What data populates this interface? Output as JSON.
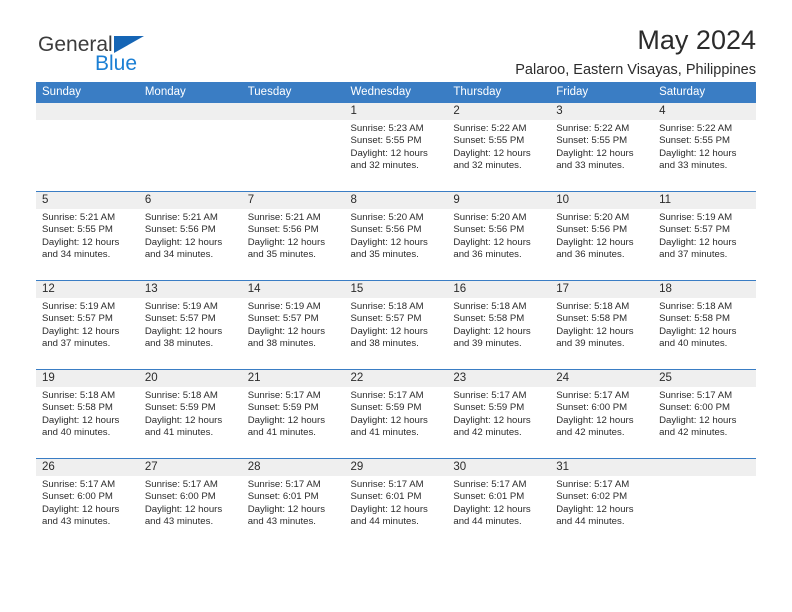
{
  "brand": {
    "name_part1": "General",
    "name_part2": "Blue",
    "accent_color": "#1b7fd4",
    "triangle_color": "#1565b5"
  },
  "header": {
    "title": "May 2024",
    "subtitle": "Palaroo, Eastern Visayas, Philippines"
  },
  "calendar": {
    "header_bg": "#3a7dc4",
    "daynum_bg": "#efefef",
    "weekday_headers": [
      "Sunday",
      "Monday",
      "Tuesday",
      "Wednesday",
      "Thursday",
      "Friday",
      "Saturday"
    ],
    "weeks": [
      [
        {
          "day": "",
          "sunrise": "",
          "sunset": "",
          "daylight_line1": "",
          "daylight_line2": ""
        },
        {
          "day": "",
          "sunrise": "",
          "sunset": "",
          "daylight_line1": "",
          "daylight_line2": ""
        },
        {
          "day": "",
          "sunrise": "",
          "sunset": "",
          "daylight_line1": "",
          "daylight_line2": ""
        },
        {
          "day": "1",
          "sunrise": "Sunrise: 5:23 AM",
          "sunset": "Sunset: 5:55 PM",
          "daylight_line1": "Daylight: 12 hours",
          "daylight_line2": "and 32 minutes."
        },
        {
          "day": "2",
          "sunrise": "Sunrise: 5:22 AM",
          "sunset": "Sunset: 5:55 PM",
          "daylight_line1": "Daylight: 12 hours",
          "daylight_line2": "and 32 minutes."
        },
        {
          "day": "3",
          "sunrise": "Sunrise: 5:22 AM",
          "sunset": "Sunset: 5:55 PM",
          "daylight_line1": "Daylight: 12 hours",
          "daylight_line2": "and 33 minutes."
        },
        {
          "day": "4",
          "sunrise": "Sunrise: 5:22 AM",
          "sunset": "Sunset: 5:55 PM",
          "daylight_line1": "Daylight: 12 hours",
          "daylight_line2": "and 33 minutes."
        }
      ],
      [
        {
          "day": "5",
          "sunrise": "Sunrise: 5:21 AM",
          "sunset": "Sunset: 5:55 PM",
          "daylight_line1": "Daylight: 12 hours",
          "daylight_line2": "and 34 minutes."
        },
        {
          "day": "6",
          "sunrise": "Sunrise: 5:21 AM",
          "sunset": "Sunset: 5:56 PM",
          "daylight_line1": "Daylight: 12 hours",
          "daylight_line2": "and 34 minutes."
        },
        {
          "day": "7",
          "sunrise": "Sunrise: 5:21 AM",
          "sunset": "Sunset: 5:56 PM",
          "daylight_line1": "Daylight: 12 hours",
          "daylight_line2": "and 35 minutes."
        },
        {
          "day": "8",
          "sunrise": "Sunrise: 5:20 AM",
          "sunset": "Sunset: 5:56 PM",
          "daylight_line1": "Daylight: 12 hours",
          "daylight_line2": "and 35 minutes."
        },
        {
          "day": "9",
          "sunrise": "Sunrise: 5:20 AM",
          "sunset": "Sunset: 5:56 PM",
          "daylight_line1": "Daylight: 12 hours",
          "daylight_line2": "and 36 minutes."
        },
        {
          "day": "10",
          "sunrise": "Sunrise: 5:20 AM",
          "sunset": "Sunset: 5:56 PM",
          "daylight_line1": "Daylight: 12 hours",
          "daylight_line2": "and 36 minutes."
        },
        {
          "day": "11",
          "sunrise": "Sunrise: 5:19 AM",
          "sunset": "Sunset: 5:57 PM",
          "daylight_line1": "Daylight: 12 hours",
          "daylight_line2": "and 37 minutes."
        }
      ],
      [
        {
          "day": "12",
          "sunrise": "Sunrise: 5:19 AM",
          "sunset": "Sunset: 5:57 PM",
          "daylight_line1": "Daylight: 12 hours",
          "daylight_line2": "and 37 minutes."
        },
        {
          "day": "13",
          "sunrise": "Sunrise: 5:19 AM",
          "sunset": "Sunset: 5:57 PM",
          "daylight_line1": "Daylight: 12 hours",
          "daylight_line2": "and 38 minutes."
        },
        {
          "day": "14",
          "sunrise": "Sunrise: 5:19 AM",
          "sunset": "Sunset: 5:57 PM",
          "daylight_line1": "Daylight: 12 hours",
          "daylight_line2": "and 38 minutes."
        },
        {
          "day": "15",
          "sunrise": "Sunrise: 5:18 AM",
          "sunset": "Sunset: 5:57 PM",
          "daylight_line1": "Daylight: 12 hours",
          "daylight_line2": "and 38 minutes."
        },
        {
          "day": "16",
          "sunrise": "Sunrise: 5:18 AM",
          "sunset": "Sunset: 5:58 PM",
          "daylight_line1": "Daylight: 12 hours",
          "daylight_line2": "and 39 minutes."
        },
        {
          "day": "17",
          "sunrise": "Sunrise: 5:18 AM",
          "sunset": "Sunset: 5:58 PM",
          "daylight_line1": "Daylight: 12 hours",
          "daylight_line2": "and 39 minutes."
        },
        {
          "day": "18",
          "sunrise": "Sunrise: 5:18 AM",
          "sunset": "Sunset: 5:58 PM",
          "daylight_line1": "Daylight: 12 hours",
          "daylight_line2": "and 40 minutes."
        }
      ],
      [
        {
          "day": "19",
          "sunrise": "Sunrise: 5:18 AM",
          "sunset": "Sunset: 5:58 PM",
          "daylight_line1": "Daylight: 12 hours",
          "daylight_line2": "and 40 minutes."
        },
        {
          "day": "20",
          "sunrise": "Sunrise: 5:18 AM",
          "sunset": "Sunset: 5:59 PM",
          "daylight_line1": "Daylight: 12 hours",
          "daylight_line2": "and 41 minutes."
        },
        {
          "day": "21",
          "sunrise": "Sunrise: 5:17 AM",
          "sunset": "Sunset: 5:59 PM",
          "daylight_line1": "Daylight: 12 hours",
          "daylight_line2": "and 41 minutes."
        },
        {
          "day": "22",
          "sunrise": "Sunrise: 5:17 AM",
          "sunset": "Sunset: 5:59 PM",
          "daylight_line1": "Daylight: 12 hours",
          "daylight_line2": "and 41 minutes."
        },
        {
          "day": "23",
          "sunrise": "Sunrise: 5:17 AM",
          "sunset": "Sunset: 5:59 PM",
          "daylight_line1": "Daylight: 12 hours",
          "daylight_line2": "and 42 minutes."
        },
        {
          "day": "24",
          "sunrise": "Sunrise: 5:17 AM",
          "sunset": "Sunset: 6:00 PM",
          "daylight_line1": "Daylight: 12 hours",
          "daylight_line2": "and 42 minutes."
        },
        {
          "day": "25",
          "sunrise": "Sunrise: 5:17 AM",
          "sunset": "Sunset: 6:00 PM",
          "daylight_line1": "Daylight: 12 hours",
          "daylight_line2": "and 42 minutes."
        }
      ],
      [
        {
          "day": "26",
          "sunrise": "Sunrise: 5:17 AM",
          "sunset": "Sunset: 6:00 PM",
          "daylight_line1": "Daylight: 12 hours",
          "daylight_line2": "and 43 minutes."
        },
        {
          "day": "27",
          "sunrise": "Sunrise: 5:17 AM",
          "sunset": "Sunset: 6:00 PM",
          "daylight_line1": "Daylight: 12 hours",
          "daylight_line2": "and 43 minutes."
        },
        {
          "day": "28",
          "sunrise": "Sunrise: 5:17 AM",
          "sunset": "Sunset: 6:01 PM",
          "daylight_line1": "Daylight: 12 hours",
          "daylight_line2": "and 43 minutes."
        },
        {
          "day": "29",
          "sunrise": "Sunrise: 5:17 AM",
          "sunset": "Sunset: 6:01 PM",
          "daylight_line1": "Daylight: 12 hours",
          "daylight_line2": "and 44 minutes."
        },
        {
          "day": "30",
          "sunrise": "Sunrise: 5:17 AM",
          "sunset": "Sunset: 6:01 PM",
          "daylight_line1": "Daylight: 12 hours",
          "daylight_line2": "and 44 minutes."
        },
        {
          "day": "31",
          "sunrise": "Sunrise: 5:17 AM",
          "sunset": "Sunset: 6:02 PM",
          "daylight_line1": "Daylight: 12 hours",
          "daylight_line2": "and 44 minutes."
        },
        {
          "day": "",
          "sunrise": "",
          "sunset": "",
          "daylight_line1": "",
          "daylight_line2": ""
        }
      ]
    ]
  }
}
